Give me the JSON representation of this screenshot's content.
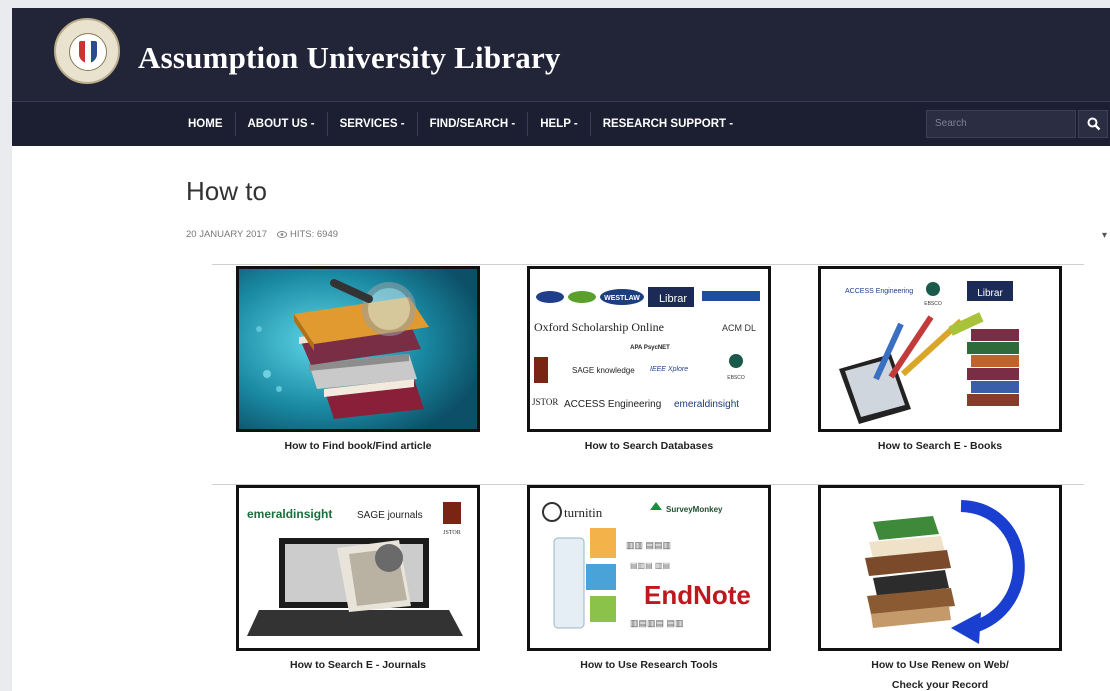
{
  "brand": {
    "title": "Assumption University Library"
  },
  "nav": {
    "items": [
      "HOME",
      "ABOUT US -",
      "SERVICES -",
      "FIND/SEARCH -",
      "HELP -",
      "RESEARCH SUPPORT -"
    ],
    "search_placeholder": "Search"
  },
  "article": {
    "title": "How to",
    "date": "20 JANUARY 2017",
    "hits": "HITS: 6949"
  },
  "cards": [
    {
      "caption": "How to Find book/Find article",
      "icon": "magnifier-books"
    },
    {
      "caption": "How to Search Databases",
      "icon": "database-logos",
      "logos": [
        "WESTLAW",
        "Librar",
        "Oxford Scholarship Online",
        "ACM DL",
        "APA PsycNET",
        "SAGE knowledge",
        "IEEE Xplore",
        "JSTOR",
        "ACCESS Engineering",
        "emeraldinsight",
        "EBSCO"
      ]
    },
    {
      "caption": "How to Search E - Books",
      "icon": "tablet-books",
      "logos": [
        "ACCESS Engineering",
        "EBSCO",
        "Librar"
      ]
    },
    {
      "caption": "How to Search E - Journals",
      "icon": "laptop-magazines",
      "logos": [
        "emeraldinsight",
        "SAGE journals",
        "JSTOR"
      ]
    },
    {
      "caption": "How to Use Research Tools",
      "icon": "research-tools",
      "logos": [
        "turnitin",
        "SurveyMonkey",
        "EndNote"
      ]
    },
    {
      "caption": "How to Use Renew on Web/\nCheck your Record",
      "caption_lines": [
        "How to Use Renew on Web/",
        "Check your Record"
      ],
      "icon": "books-renew-arrow"
    }
  ],
  "colors": {
    "header": "#222538",
    "navbar": "#1c1f31",
    "accent_blue": "#1a3fd0"
  }
}
